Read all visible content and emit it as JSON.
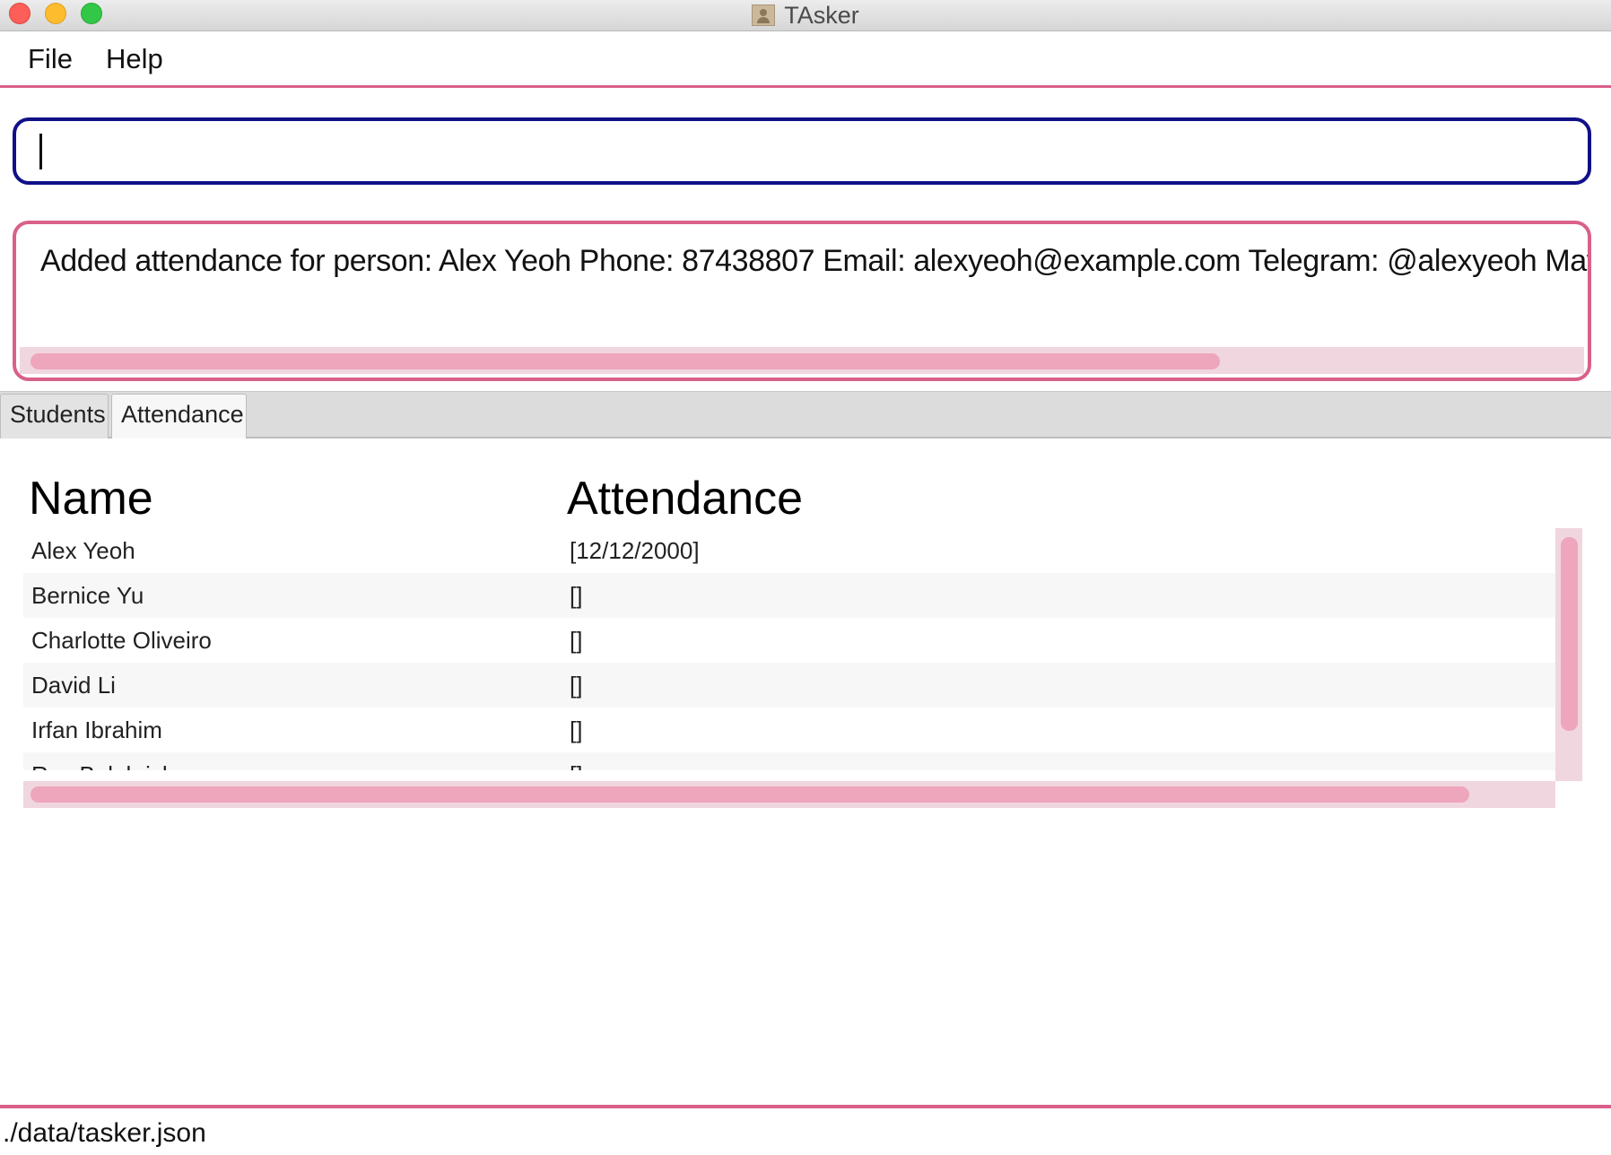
{
  "window": {
    "title": "TAsker",
    "app_icon": "contacts-book-icon"
  },
  "menu": {
    "file": "File",
    "help": "Help"
  },
  "command": {
    "value": "",
    "placeholder": ""
  },
  "result": {
    "message": "Added attendance for person: Alex Yeoh Phone: 87438807 Email: alexyeoh@example.com Telegram: @alexyeoh Matri"
  },
  "tabs": [
    {
      "label": "Students",
      "selected": false
    },
    {
      "label": "Attendance",
      "selected": true
    }
  ],
  "table": {
    "headers": {
      "name": "Name",
      "attendance": "Attendance"
    },
    "rows": [
      {
        "name": "Alex Yeoh",
        "attendance": "[12/12/2000]"
      },
      {
        "name": "Bernice Yu",
        "attendance": "[]"
      },
      {
        "name": "Charlotte Oliveiro",
        "attendance": "[]"
      },
      {
        "name": "David Li",
        "attendance": "[]"
      },
      {
        "name": "Irfan Ibrahim",
        "attendance": "[]"
      },
      {
        "name": "Roy Balakrishnan",
        "attendance": "[]"
      }
    ]
  },
  "status": {
    "path": "./data/tasker.json"
  },
  "colors": {
    "accent_pink": "#d9608a",
    "command_border": "#101088",
    "scroll_track": "#f0d6df",
    "scroll_thumb": "#eea6bd"
  }
}
